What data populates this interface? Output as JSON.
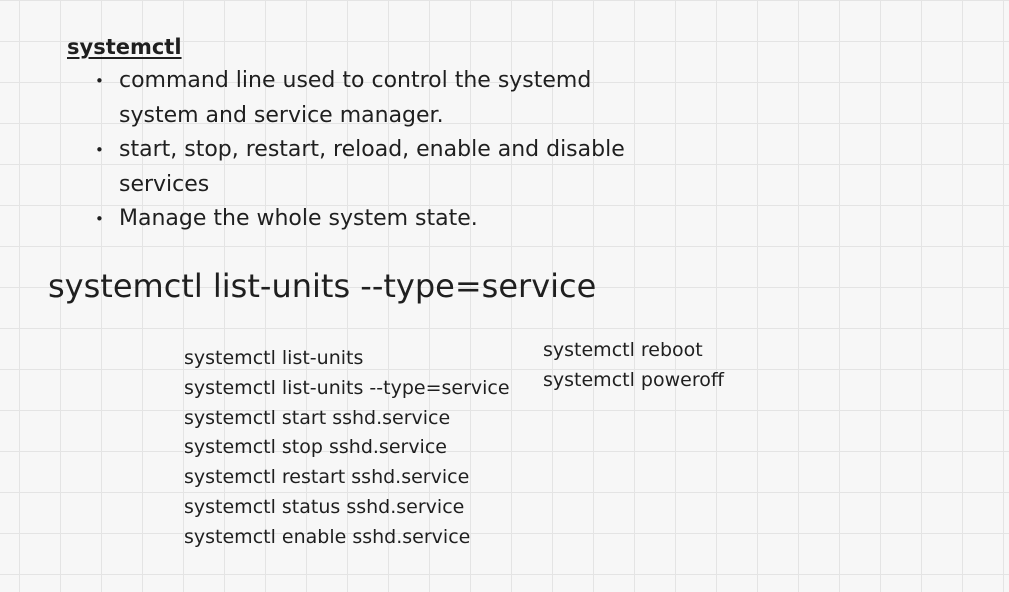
{
  "heading": "systemctl",
  "bullets": [
    "command line used to control the systemd system and service manager.",
    "start, stop, restart, reload, enable and disable services",
    "Manage the whole system state."
  ],
  "big_command": "systemctl list-units --type=service",
  "commands_left": [
    "systemctl list-units",
    "systemctl list-units --type=service",
    "systemctl start sshd.service",
    "systemctl stop sshd.service",
    "systemctl restart sshd.service",
    "systemctl status sshd.service",
    "systemctl enable sshd.service"
  ],
  "commands_right": [
    "systemctl reboot",
    "systemctl poweroff"
  ]
}
